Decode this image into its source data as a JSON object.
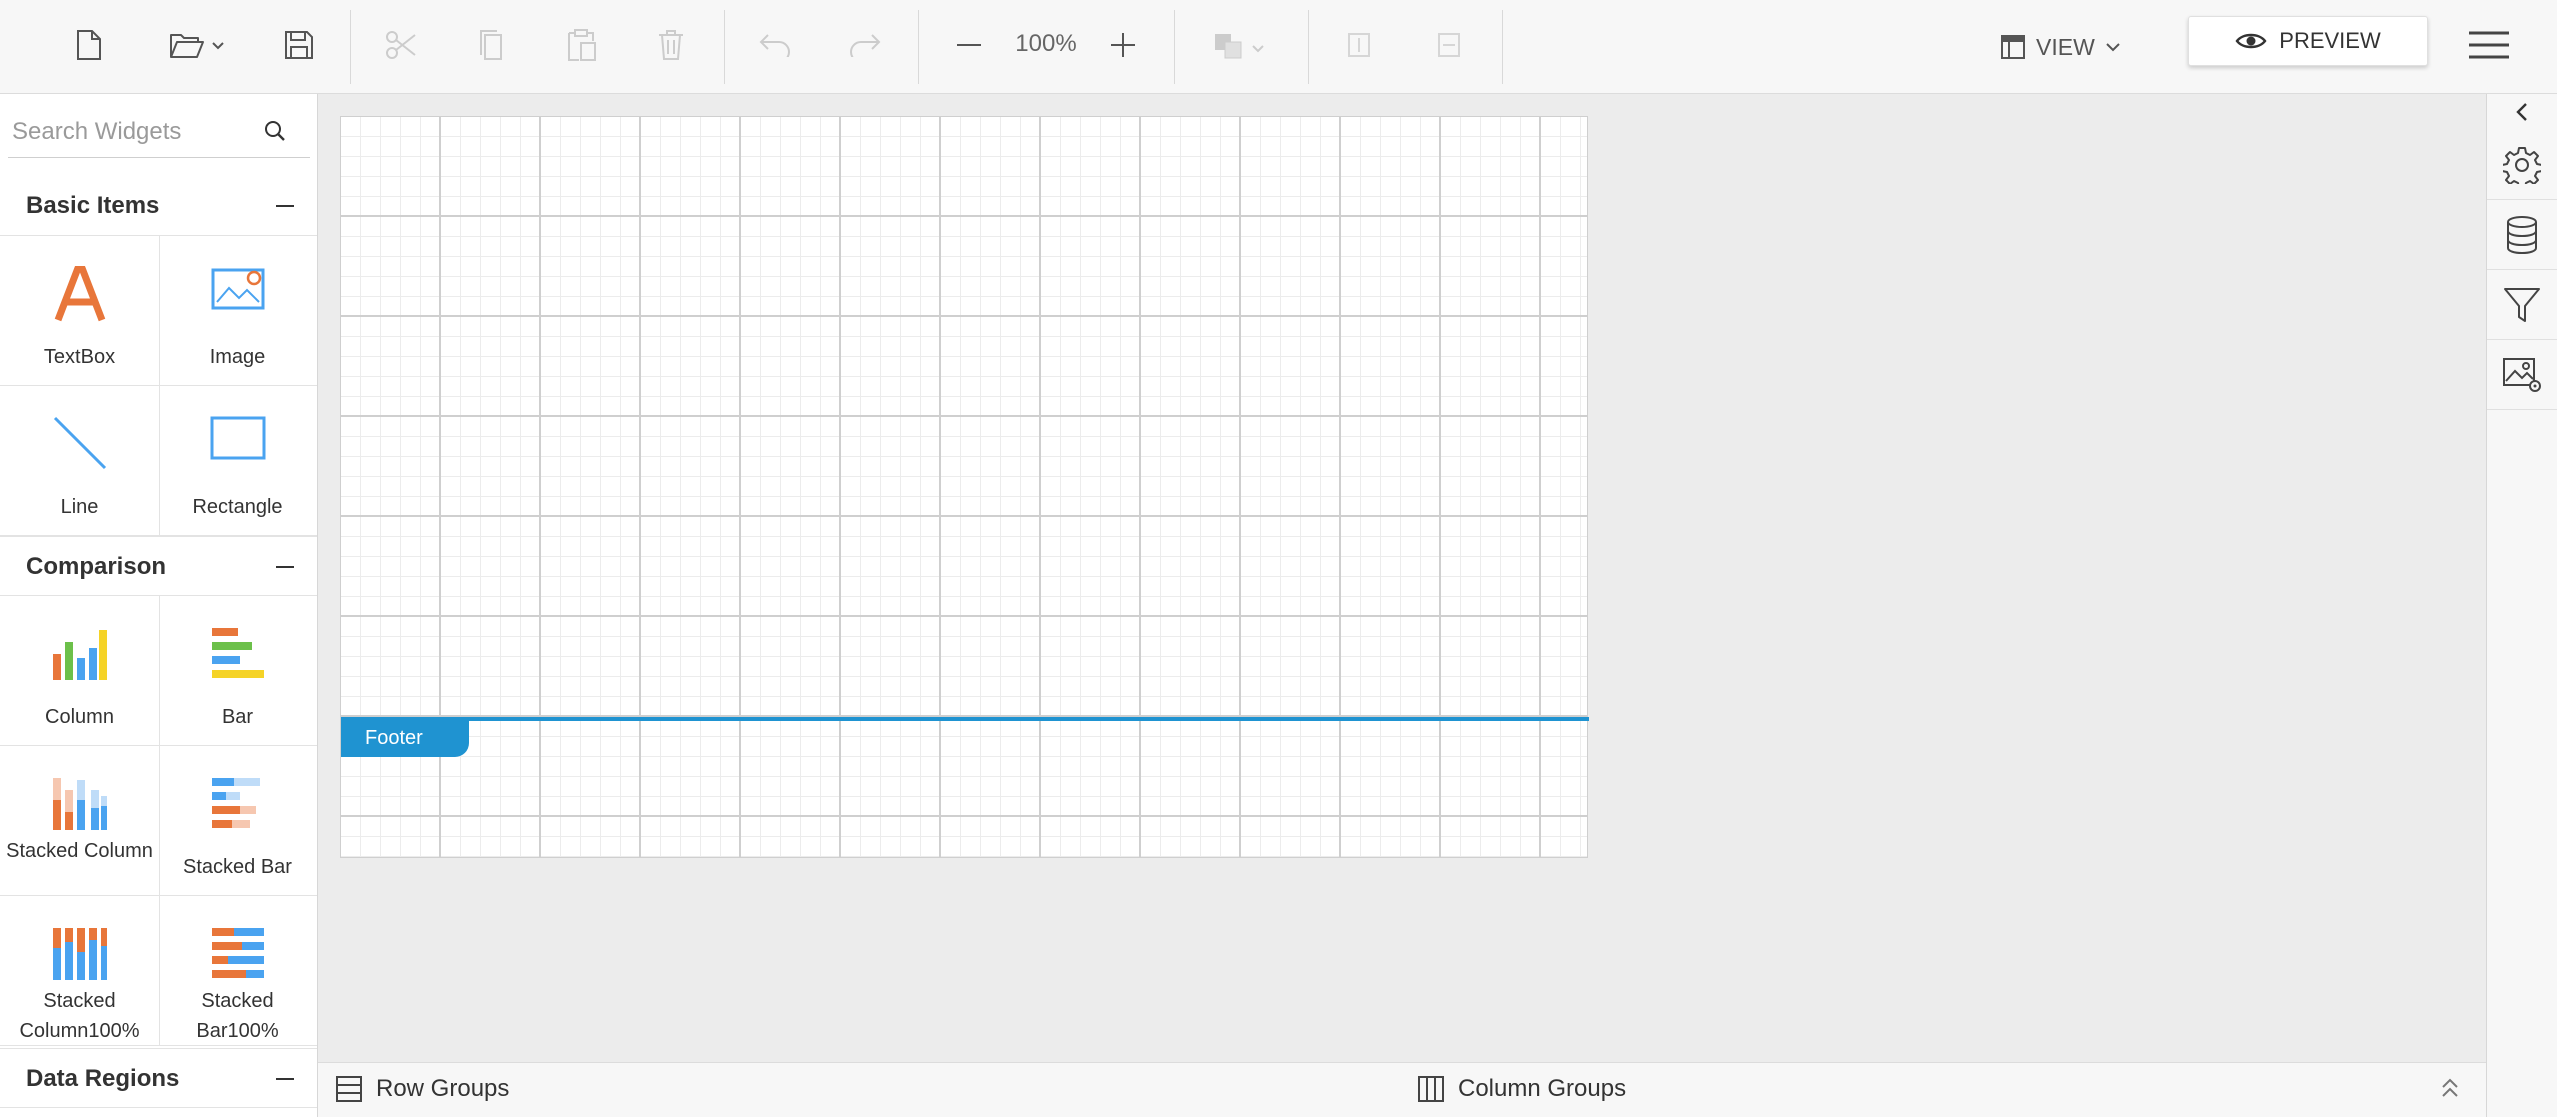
{
  "toolbar": {
    "zoom_value": "100%",
    "view_label": "VIEW",
    "preview_label": "PREVIEW"
  },
  "widgets": {
    "search_placeholder": "Search Widgets",
    "categories": [
      {
        "title": "Basic Items",
        "items": [
          "TextBox",
          "Image",
          "Line",
          "Rectangle"
        ]
      },
      {
        "title": "Comparison",
        "items": [
          "Column",
          "Bar",
          "Stacked Column",
          "Stacked Bar",
          "Stacked Column100%",
          "Stacked Bar100%"
        ]
      },
      {
        "title": "Data Regions",
        "items": []
      }
    ]
  },
  "canvas": {
    "footer_label": "Footer"
  },
  "groups_bar": {
    "row_groups_label": "Row Groups",
    "column_groups_label": "Column Groups"
  },
  "colors": {
    "accent": "#1f93d1",
    "orange": "#e8763a",
    "blue": "#4aa3f0",
    "green": "#6cc04a",
    "yellow": "#f5d327"
  },
  "icons": {
    "toolbar": [
      "new-file-icon",
      "open-folder-icon",
      "save-icon",
      "cut-icon",
      "copy-icon",
      "paste-icon",
      "delete-icon",
      "undo-icon",
      "redo-icon",
      "zoom-out-icon",
      "zoom-in-icon",
      "arrange-icon",
      "bring-forward-icon",
      "send-backward-icon",
      "view-layout-icon",
      "eye-icon",
      "hamburger-menu-icon"
    ],
    "right_panel": [
      "collapse-left-icon",
      "gear-icon",
      "database-icon",
      "filter-icon",
      "image-settings-icon"
    ]
  }
}
